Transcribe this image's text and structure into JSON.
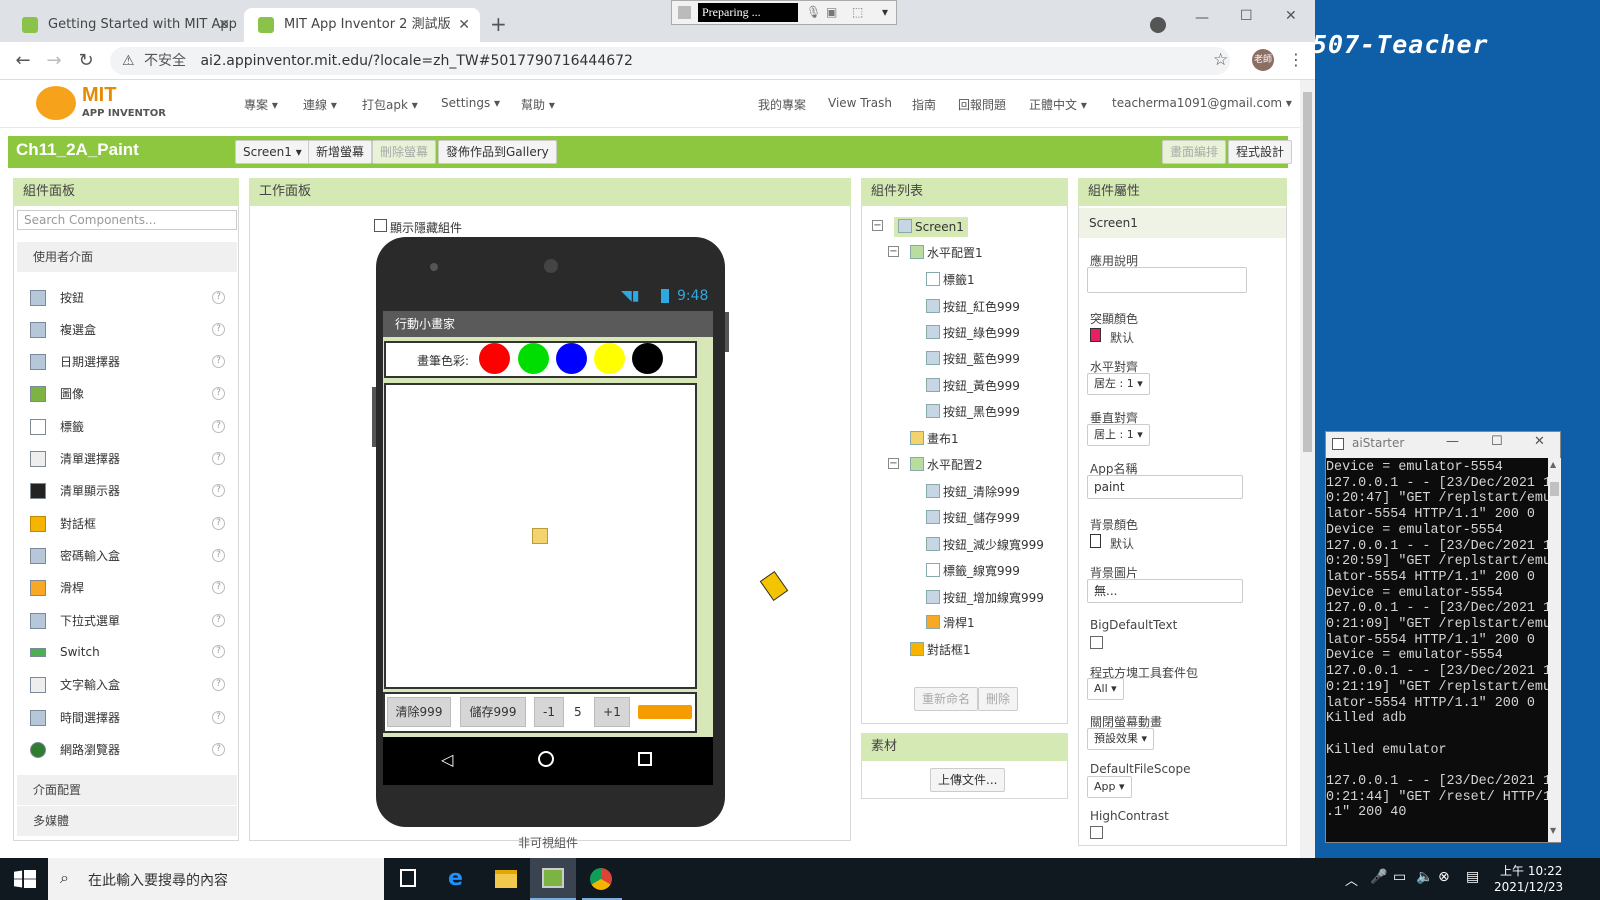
{
  "browser": {
    "tabs": [
      {
        "title": "Getting Started with MIT App"
      },
      {
        "title": "MIT App Inventor 2 測試版"
      }
    ],
    "recording_status": "Preparing ...",
    "address": {
      "insecure_label": "不安全",
      "url": "ai2.appinventor.mit.edu/?locale=zh_TW#5017790716444672"
    },
    "profile_label": "老師"
  },
  "desktop_banner": "507-Teacher",
  "app": {
    "logo": {
      "line1": "MIT",
      "line2": "APP INVENTOR"
    },
    "menus": [
      "專案",
      "連線",
      "打包apk",
      "Settings",
      "幫助"
    ],
    "right_links": [
      "我的專案",
      "View Trash",
      "指南",
      "回報問題",
      "正體中文",
      "teacherma1091@gmail.com"
    ],
    "project_title": "Ch11_2A_Paint",
    "screen_select": "Screen1",
    "toolbar": {
      "add_screen": "新增螢幕",
      "remove_screen": "刪除螢幕",
      "publish": "發佈作品到Gallery",
      "designer": "畫面編排",
      "blocks": "程式設計"
    }
  },
  "palette": {
    "title": "組件面板",
    "search_placeholder": "Search Components...",
    "category": "使用者介面",
    "items": [
      "按鈕",
      "複選盒",
      "日期選擇器",
      "圖像",
      "標籤",
      "清單選擇器",
      "清單顯示器",
      "對話框",
      "密碼輸入盒",
      "滑桿",
      "下拉式選單",
      "Switch",
      "文字輸入盒",
      "時間選擇器",
      "網路瀏覽器"
    ],
    "help": "?",
    "categories_below": [
      "介面配置",
      "多媒體"
    ]
  },
  "viewer": {
    "title": "工作面板",
    "show_hidden": "顯示隱藏組件",
    "status_time": "9:48",
    "app_title": "行動小畫家",
    "color_label": "畫筆色彩:",
    "swatches": [
      "#ff0000",
      "#00dd00",
      "#0000ff",
      "#ffff00",
      "#000000"
    ],
    "buttons": {
      "clear": "清除999",
      "save": "儲存999",
      "minus": "-1",
      "width_value": "5",
      "plus": "+1"
    },
    "nonvisible": "非可視組件"
  },
  "tree": {
    "title": "組件列表",
    "items": [
      {
        "label": "Screen1",
        "level": 0
      },
      {
        "label": "水平配置1",
        "level": 1
      },
      {
        "label": "標籤1",
        "level": 2
      },
      {
        "label": "按鈕_紅色999",
        "level": 2
      },
      {
        "label": "按鈕_綠色999",
        "level": 2
      },
      {
        "label": "按鈕_藍色999",
        "level": 2
      },
      {
        "label": "按鈕_黃色999",
        "level": 2
      },
      {
        "label": "按鈕_黑色999",
        "level": 2
      },
      {
        "label": "畫布1",
        "level": 1
      },
      {
        "label": "水平配置2",
        "level": 1
      },
      {
        "label": "按鈕_清除999",
        "level": 2
      },
      {
        "label": "按鈕_儲存999",
        "level": 2
      },
      {
        "label": "按鈕_減少線寬999",
        "level": 2
      },
      {
        "label": "標籤_線寬999",
        "level": 2
      },
      {
        "label": "按鈕_增加線寬999",
        "level": 2
      },
      {
        "label": "滑桿1",
        "level": 2
      },
      {
        "label": "對話框1",
        "level": 1
      }
    ],
    "rename": "重新命名",
    "delete": "刪除",
    "media_title": "素材",
    "upload": "上傳文件..."
  },
  "properties": {
    "title": "組件屬性",
    "component": "Screen1",
    "about_label": "應用說明",
    "accent_label": "突顯顏色",
    "accent_value": "默认",
    "accent_color": "#e91e63",
    "halign_label": "水平對齊",
    "halign_value": "居左 : 1",
    "valign_label": "垂直對齊",
    "valign_value": "居上 : 1",
    "appname_label": "App名稱",
    "appname_value": "paint",
    "bgcolor_label": "背景顏色",
    "bgcolor_value": "默认",
    "bgimage_label": "背景圖片",
    "bgimage_value": "無...",
    "bigtext_label": "BigDefaultText",
    "toolkit_label": "程式方塊工具套件包",
    "toolkit_value": "All",
    "anim_label": "關閉螢幕動畫",
    "anim_value": "預設效果",
    "scope_label": "DefaultFileScope",
    "scope_value": "App",
    "contrast_label": "HighContrast"
  },
  "terminal": {
    "title": "aiStarter",
    "lines": "Device = emulator-5554\n127.0.0.1 - - [23/Dec/2021 1\n0:20:47] \"GET /replstart/emu\nlator-5554 HTTP/1.1\" 200 0\nDevice = emulator-5554\n127.0.0.1 - - [23/Dec/2021 1\n0:20:59] \"GET /replstart/emu\nlator-5554 HTTP/1.1\" 200 0\nDevice = emulator-5554\n127.0.0.1 - - [23/Dec/2021 1\n0:21:09] \"GET /replstart/emu\nlator-5554 HTTP/1.1\" 200 0\nDevice = emulator-5554\n127.0.0.1 - - [23/Dec/2021 1\n0:21:19] \"GET /replstart/emu\nlator-5554 HTTP/1.1\" 200 0\nKilled adb\n\nKilled emulator\n\n127.0.0.1 - - [23/Dec/2021 1\n0:21:44] \"GET /reset/ HTTP/1\n.1\" 200 40"
  },
  "taskbar": {
    "search_placeholder": "在此輸入要搜尋的內容",
    "time": "上午 10:22",
    "date": "2021/12/23"
  }
}
